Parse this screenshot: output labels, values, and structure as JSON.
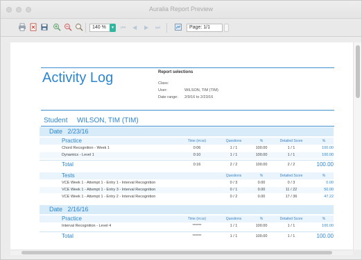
{
  "window": {
    "title": "Auralia Report Preview"
  },
  "toolbar": {
    "zoom_value": "140 %",
    "zoom_dropdown_glyph": "▾",
    "page_value": "Page: 1/1",
    "icons": [
      "print-icon",
      "pdf-export-icon",
      "save-icon",
      "zoom-in-icon",
      "zoom-out-icon",
      "zoom-fit-icon",
      "first-page-icon",
      "prev-page-icon",
      "next-page-icon",
      "last-page-icon",
      "page-setup-icon"
    ],
    "nav_glyphs": {
      "first": "⏮",
      "prev": "◀",
      "next": "▶",
      "last": "⏭"
    }
  },
  "report": {
    "title": "Activity Log",
    "selections": {
      "heading": "Report selections",
      "class_label": "Class:",
      "class_value": "",
      "user_label": "User:",
      "user_value": "WILSON, TIM (TIM)",
      "date_label": "Date range:",
      "date_value": "2/9/16 to 2/23/16"
    },
    "student_label": "Student",
    "student_name": "WILSON, TIM (TIM)",
    "columns": {
      "time": "Time (m:ss)",
      "questions": "Questions",
      "percent": "%",
      "detailed": "Detailed Score",
      "detailed_percent": "%"
    },
    "dates": [
      {
        "label": "Date",
        "date": "2/23/16",
        "practice": {
          "title": "Practice",
          "rows": [
            {
              "name": "Chord Recognition - Week 1",
              "time": "0:06",
              "questions": "1 / 1",
              "percent": "100.00",
              "detailed": "1 / 1",
              "detailed_percent": "100.00"
            },
            {
              "name": "Dynamics - Level 1",
              "time": "0:10",
              "questions": "1 / 1",
              "percent": "100.00",
              "detailed": "1 / 1",
              "detailed_percent": "100.00"
            }
          ],
          "total": {
            "label": "Total",
            "time": "0:16",
            "questions": "2 / 2",
            "percent": "100.00",
            "detailed": "2 / 2",
            "detailed_percent": "100.00"
          }
        },
        "tests": {
          "title": "Tests",
          "rows": [
            {
              "name": "VCE Week 1 - Attempt 1 - Entry 1 - Interval Recognition",
              "questions": "0 / 3",
              "percent": "0.00",
              "detailed": "0 / 3",
              "detailed_percent": "0.00"
            },
            {
              "name": "VCE Week 1 - Attempt 1 - Entry 3 - Interval Recognition",
              "questions": "0 / 1",
              "percent": "0.00",
              "detailed": "11 / 22",
              "detailed_percent": "50.00"
            },
            {
              "name": "VCE Week 1 - Attempt 1 - Entry 2 - Interval Recognition",
              "questions": "0 / 2",
              "percent": "0.00",
              "detailed": "17 / 36",
              "detailed_percent": "47.22"
            }
          ]
        }
      },
      {
        "label": "Date",
        "date": "2/16/16",
        "practice": {
          "title": "Practice",
          "rows": [
            {
              "name": "Interval Recognition - Level 4",
              "time": "******",
              "questions": "1 / 1",
              "percent": "100.00",
              "detailed": "1 / 1",
              "detailed_percent": "100.00"
            }
          ],
          "total": {
            "label": "Total",
            "time": "******",
            "questions": "1 / 1",
            "percent": "100.00",
            "detailed": "1 / 1",
            "detailed_percent": "100.00"
          }
        }
      }
    ]
  },
  "colors": {
    "accent": "#2c86cf",
    "band": "#d7ebf9",
    "zoom_button": "#2fb7a0"
  }
}
